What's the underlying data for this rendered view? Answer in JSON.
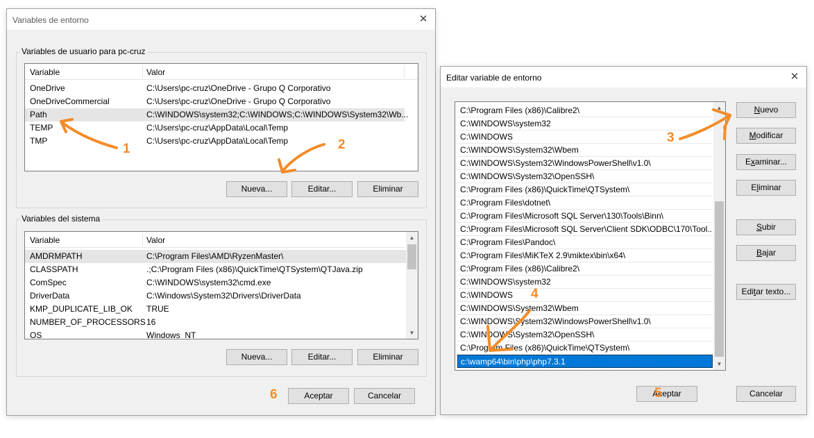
{
  "env_dialog": {
    "title": "Variables de entorno",
    "close_glyph": "✕",
    "user_group": {
      "label": "Variables de usuario para pc-cruz",
      "headers": [
        "Variable",
        "Valor"
      ],
      "rows": [
        {
          "name": "OneDrive",
          "value": "C:\\Users\\pc-cruz\\OneDrive - Grupo Q Corporativo"
        },
        {
          "name": "OneDriveCommercial",
          "value": "C:\\Users\\pc-cruz\\OneDrive - Grupo Q Corporativo"
        },
        {
          "name": "Path",
          "value": "C:\\WINDOWS\\system32;C:\\WINDOWS;C:\\WINDOWS\\System32\\Wb..."
        },
        {
          "name": "TEMP",
          "value": "C:\\Users\\pc-cruz\\AppData\\Local\\Temp"
        },
        {
          "name": "TMP",
          "value": "C:\\Users\\pc-cruz\\AppData\\Local\\Temp"
        }
      ],
      "buttons": {
        "new": "Nueva...",
        "edit": "Editar...",
        "delete": "Eliminar"
      }
    },
    "system_group": {
      "label": "Variables del sistema",
      "headers": [
        "Variable",
        "Valor"
      ],
      "rows": [
        {
          "name": "AMDRMPATH",
          "value": "C:\\Program Files\\AMD\\RyzenMaster\\"
        },
        {
          "name": "CLASSPATH",
          "value": ".;C:\\Program Files (x86)\\QuickTime\\QTSystem\\QTJava.zip"
        },
        {
          "name": "ComSpec",
          "value": "C:\\WINDOWS\\system32\\cmd.exe"
        },
        {
          "name": "DriverData",
          "value": "C:\\Windows\\System32\\Drivers\\DriverData"
        },
        {
          "name": "KMP_DUPLICATE_LIB_OK",
          "value": "TRUE"
        },
        {
          "name": "NUMBER_OF_PROCESSORS",
          "value": "16"
        },
        {
          "name": "OS",
          "value": "Windows_NT"
        }
      ],
      "buttons": {
        "new": "Nueva...",
        "edit": "Editar...",
        "delete": "Eliminar"
      }
    },
    "ok": "Aceptar",
    "cancel": "Cancelar"
  },
  "edit_dialog": {
    "title": "Editar variable de entorno",
    "close_glyph": "✕",
    "paths": [
      "C:\\Program Files (x86)\\Calibre2\\",
      "C:\\WINDOWS\\system32",
      "C:\\WINDOWS",
      "C:\\WINDOWS\\System32\\Wbem",
      "C:\\WINDOWS\\System32\\WindowsPowerShell\\v1.0\\",
      "C:\\WINDOWS\\System32\\OpenSSH\\",
      "C:\\Program Files (x86)\\QuickTime\\QTSystem\\",
      "C:\\Program Files\\dotnet\\",
      "C:\\Program Files\\Microsoft SQL Server\\130\\Tools\\Binn\\",
      "C:\\Program Files\\Microsoft SQL Server\\Client SDK\\ODBC\\170\\Tool...",
      "C:\\Program Files\\Pandoc\\",
      "C:\\Program Files\\MiKTeX 2.9\\miktex\\bin\\x64\\",
      "C:\\Program Files (x86)\\Calibre2\\",
      "C:\\WINDOWS\\system32",
      "C:\\WINDOWS",
      "C:\\WINDOWS\\System32\\Wbem",
      "C:\\WINDOWS\\System32\\WindowsPowerShell\\v1.0\\",
      "C:\\WINDOWS\\System32\\OpenSSH\\",
      "C:\\Program Files (x86)\\QuickTime\\QTSystem\\",
      "c:\\wamp64\\bin\\php\\php7.3.1"
    ],
    "selected_index": 19,
    "buttons": {
      "new": {
        "pre": "",
        "u": "N",
        "post": "uevo"
      },
      "modify": {
        "pre": "",
        "u": "M",
        "post": "odificar"
      },
      "browse": {
        "pre": "E",
        "u": "x",
        "post": "aminar..."
      },
      "delete": {
        "pre": "E",
        "u": "l",
        "post": "iminar"
      },
      "up": {
        "pre": "",
        "u": "S",
        "post": "ubir"
      },
      "down": {
        "pre": "",
        "u": "B",
        "post": "ajar"
      },
      "edit_text": {
        "pre": "Edi",
        "u": "t",
        "post": "ar texto..."
      }
    },
    "ok": "Aceptar",
    "cancel": "Cancelar"
  },
  "annotations": {
    "a1": "1",
    "a2": "2",
    "a3": "3",
    "a4": "4",
    "a5": "5",
    "a6": "6",
    "color": "#f28c28"
  },
  "colors": {
    "selection": "#0078d7",
    "dialog_bg": "#f0f0f0",
    "button_bg": "#e1e1e1"
  }
}
